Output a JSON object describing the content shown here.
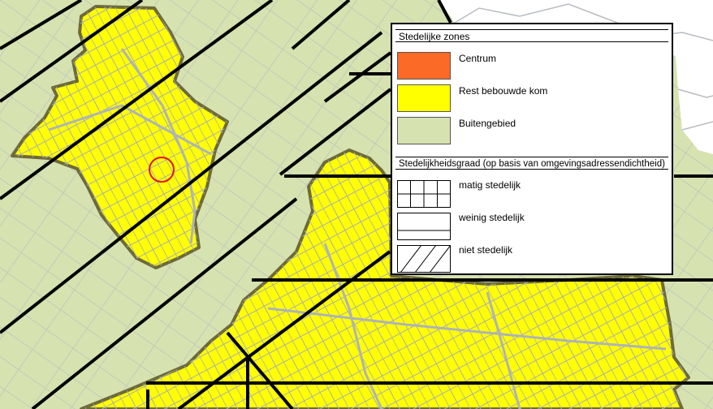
{
  "legend": {
    "zones_title": "Stedelijke zones",
    "zones": [
      {
        "label": "Centrum",
        "color": "#fb6a27"
      },
      {
        "label": "Rest bebouwde kom",
        "color": "#ffff00"
      },
      {
        "label": "Buitengebied",
        "color": "#d6e2b0"
      }
    ],
    "density_title": "Stedelijkheidsgraad (op basis van omgevingsadressendichtheid)",
    "density": [
      {
        "label": "matig stedelijk",
        "pattern": "grid-icon"
      },
      {
        "label": "weinig stedelijk",
        "pattern": "horizontal-lines-icon"
      },
      {
        "label": "niet stedelijk",
        "pattern": "diagonal-lines-icon"
      }
    ]
  },
  "colors": {
    "buitengebied": "#d6e2b0",
    "bebouwde_kom": "#ffff00",
    "zone_outline": "#6d6a3a",
    "hatch": "#000000",
    "parcels": "#aeb3b8",
    "marker": "#e0141c"
  }
}
